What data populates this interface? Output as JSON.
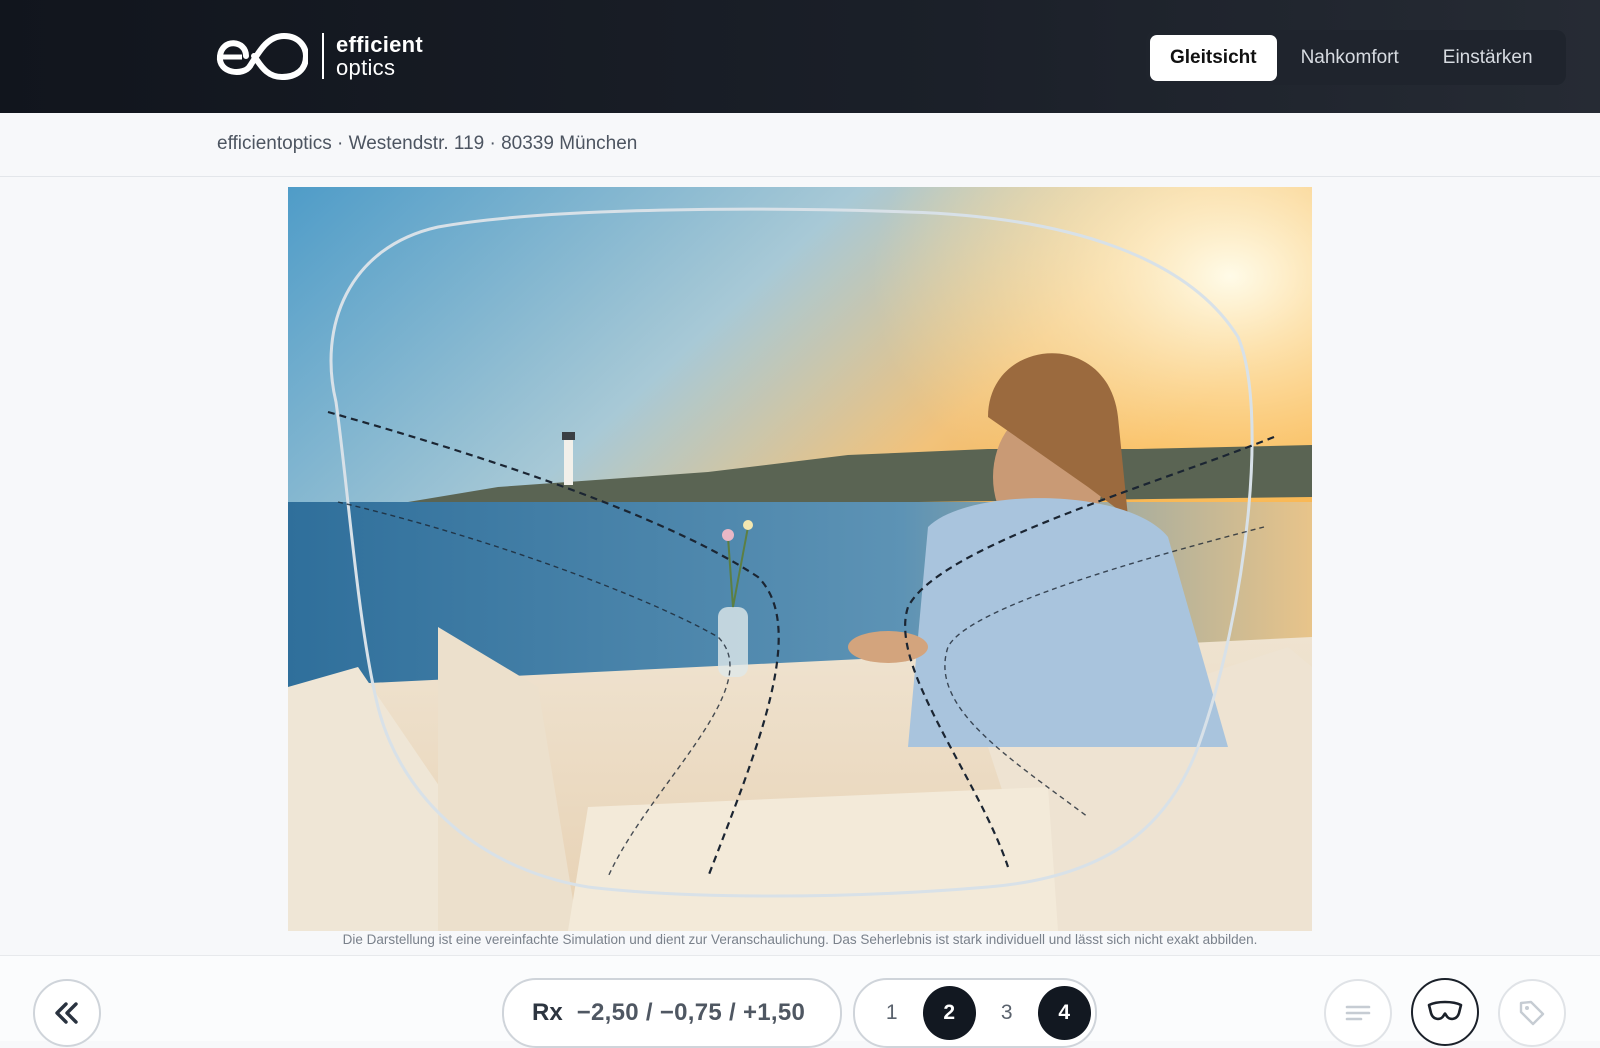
{
  "header": {
    "logo": {
      "line1": "efficient",
      "line2": "optics"
    },
    "tabs": [
      {
        "label": "Gleitsicht",
        "active": true
      },
      {
        "label": "Nahkomfort",
        "active": false
      },
      {
        "label": "Einstärken",
        "active": false
      }
    ]
  },
  "store": {
    "address": "efficientoptics · Westendstr. 119 · 80339 München"
  },
  "simulation": {
    "disclaimer": "Die Darstellung ist eine vereinfachte Simulation und dient zur Veranschaulichung. Das Seherlebnis ist stark individuell und lässt sich nicht exakt abbilden."
  },
  "footer": {
    "back_icon": "double-chevron-left-icon",
    "rx_label": "Rx",
    "rx_value": "−2,50 / −0,75 / +1,50",
    "steps": [
      {
        "label": "1",
        "active": false
      },
      {
        "label": "2",
        "active": true
      },
      {
        "label": "3",
        "active": false
      },
      {
        "label": "4",
        "active": true
      }
    ],
    "icons": [
      "menu-lines-icon",
      "glasses-lens-icon",
      "price-tag-icon"
    ]
  },
  "colors": {
    "header_bg": "#11151d",
    "active_step": "#121821",
    "accent": "#ffffff"
  }
}
